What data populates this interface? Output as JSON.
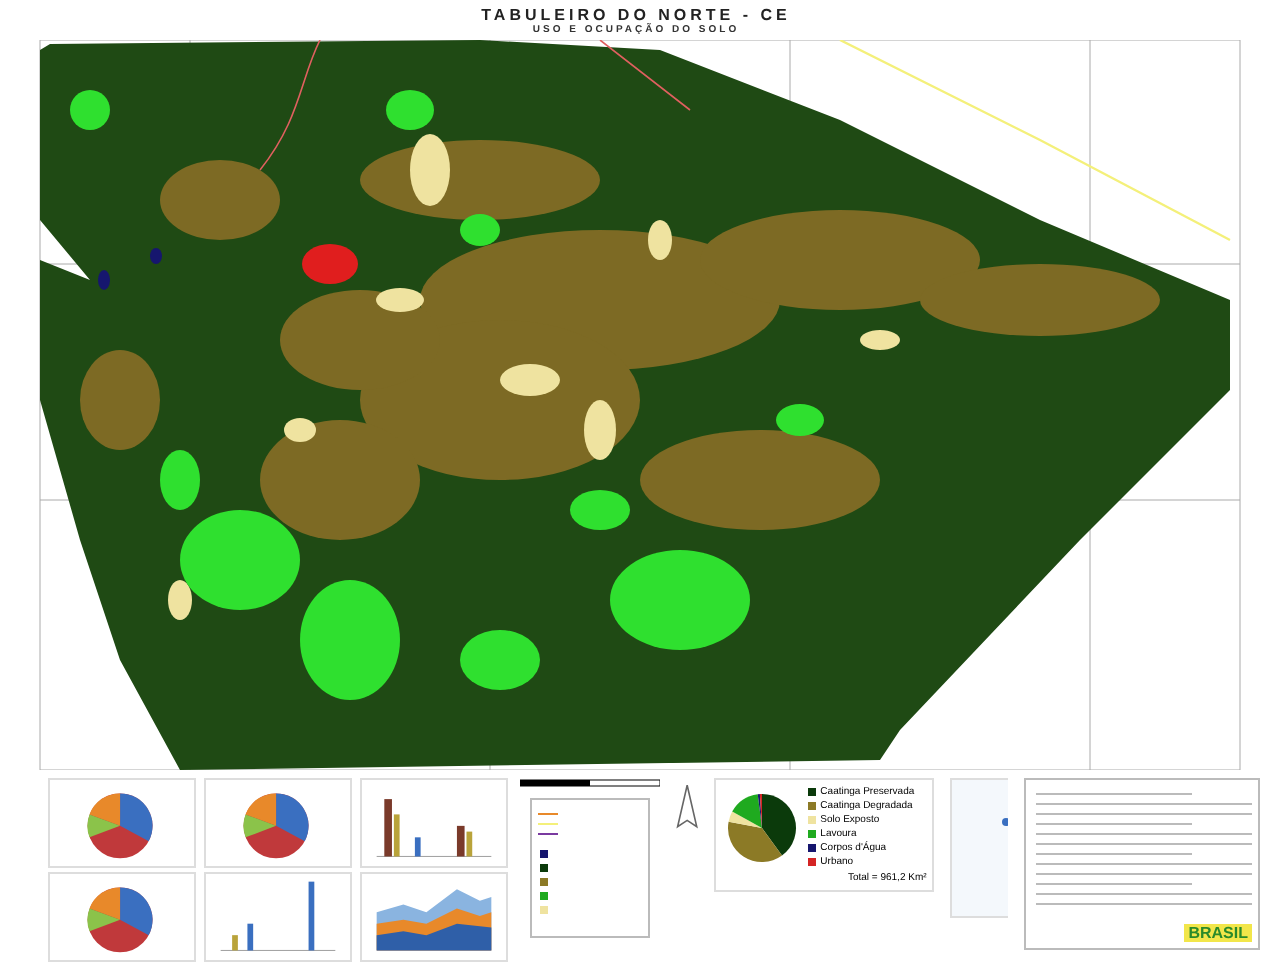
{
  "title": "TABULEIRO DO NORTE - CE",
  "subtitle": "USO E OCUPAÇÃO DO SOLO",
  "land_use_chart": {
    "legend": [
      {
        "label": "Caatinga Preservada",
        "color": "#0b3a0b"
      },
      {
        "label": "Caatinga Degradada",
        "color": "#8c7a26"
      },
      {
        "label": "Solo Exposto",
        "color": "#efe3a0"
      },
      {
        "label": "Lavoura",
        "color": "#1faa1f"
      },
      {
        "label": "Corpos d'Água",
        "color": "#16166e"
      },
      {
        "label": "Urbano",
        "color": "#d42424"
      }
    ],
    "total": "Total = 961,2 Km²"
  },
  "logo": "BRASIL"
}
